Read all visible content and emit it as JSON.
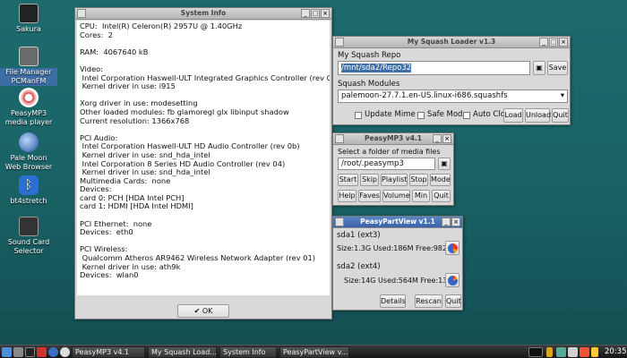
{
  "desktop": {
    "icons": [
      {
        "label_1": "Sakura",
        "label_2": ""
      },
      {
        "label_1": "File Manager",
        "label_2": "PCManFM"
      },
      {
        "label_1": "PeasyMP3",
        "label_2": "media player"
      },
      {
        "label_1": "Pale Moon",
        "label_2": "Web Browser"
      },
      {
        "label_1": "bt4stretch",
        "label_2": ""
      },
      {
        "label_1": "Sound Card",
        "label_2": "Selector"
      }
    ]
  },
  "sysinfo": {
    "title": "System Info",
    "lines": [
      "CPU:  Intel(R) Celeron(R) 2957U @ 1.40GHz",
      "Cores:  2",
      "",
      "RAM:  4067640 kB",
      "",
      "Video:",
      " Intel Corporation Haswell-ULT Integrated Graphics Controller (rev 0b)",
      " Kernel driver in use: i915",
      "",
      "Xorg driver in use: modesetting",
      "Other loaded modules: fb glamoregl glx libinput shadow",
      "Current resolution: 1366x768",
      "",
      "PCI Audio:",
      " Intel Corporation Haswell-ULT HD Audio Controller (rev 0b)",
      " Kernel driver in use: snd_hda_intel",
      " Intel Corporation 8 Series HD Audio Controller (rev 04)",
      " Kernel driver in use: snd_hda_intel",
      "Multimedia Cards:  none",
      "Devices:",
      "card 0: PCH [HDA Intel PCH]",
      "card 1: HDMI [HDA Intel HDMI]",
      "",
      "PCI Ethernet:  none",
      "Devices:  eth0",
      "",
      "PCI Wireless:",
      " Qualcomm Atheros AR9462 Wireless Network Adapter (rev 01)",
      " Kernel driver in use: ath9k",
      "Devices:  wlan0"
    ],
    "ok_label": "OK"
  },
  "squash": {
    "title": "My Squash Loader v1.3",
    "repo_label": "My Squash Repo",
    "repo_value": "/mnt/sda2/Repo32",
    "save_label": "Save",
    "modules_label": "Squash Modules",
    "module_selected": "palemoon-27.7.1.en-US.linux-i686.squashfs",
    "update_mime": "Update Mime",
    "safe_mode": "Safe Mode",
    "auto_close": "Auto Close",
    "load": "Load",
    "unload": "Unload",
    "quit": "Quit"
  },
  "peasymp3": {
    "title": "PeasyMP3 v4.1",
    "folder_label": "Select a folder of media files",
    "folder_value": "/root/.peasymp3",
    "buttons_row1": [
      "Start",
      "Skip",
      "Playlist",
      "Stop",
      "Mode"
    ],
    "buttons_row2": [
      "Help",
      "Faves",
      "Volume",
      "Min",
      "Quit"
    ]
  },
  "partview": {
    "title": "PeasyPartView v1.1",
    "sda1_label": "sda1 (ext3)",
    "sda1_stats": "Size:1.3G  Used:186M   Free:982M",
    "sda2_label": "sda2 (ext4)",
    "sda2_stats": "Size:14G  Used:564M  Free:13G",
    "details": "Details",
    "rescan": "Rescan",
    "quit": "Quit"
  },
  "taskbar": {
    "tasks": [
      "PeasyMP3 v4.1",
      "My Squash Load...",
      "System Info",
      "PeasyPartView v..."
    ],
    "clock": "20:35"
  }
}
